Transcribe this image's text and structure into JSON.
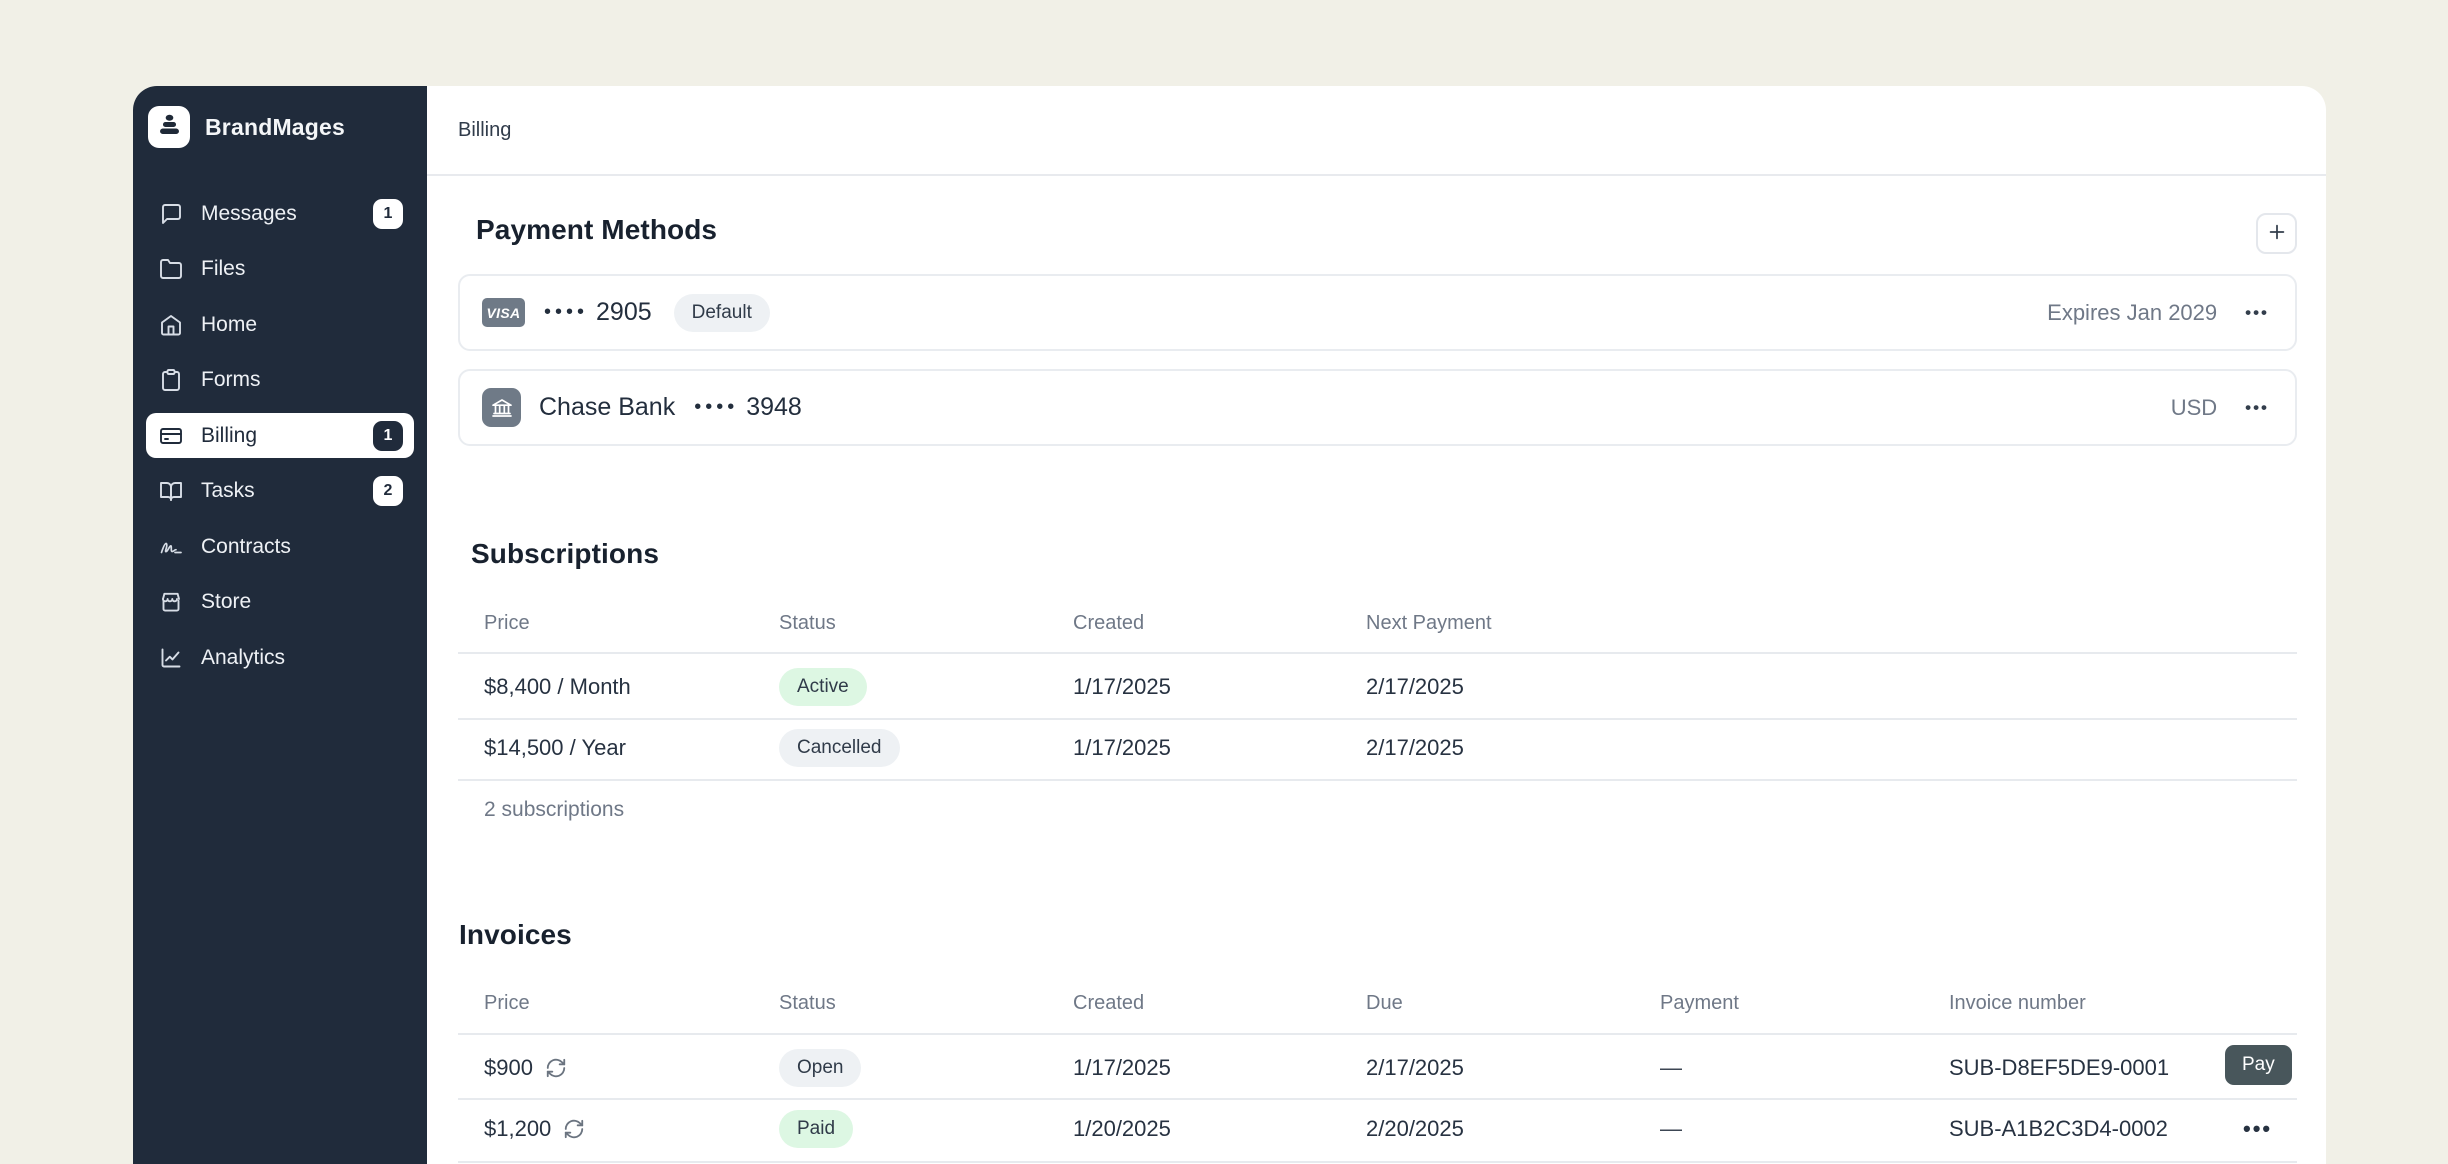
{
  "brand": {
    "name": "BrandMages",
    "logo_icon": "stacked-stones-icon"
  },
  "colors": {
    "page_bg": "#f1f0e7",
    "sidebar_bg": "#202b3b",
    "panel_bg": "#ffffff",
    "accent_dark": "#202b3b",
    "pill_green_bg": "#ddf7e3",
    "pill_gray_bg": "#eef1f4",
    "pay_button_bg": "#48565b",
    "card_brand_bg": "#6f7a87"
  },
  "sidebar": {
    "items": [
      {
        "label": "Messages",
        "icon": "chat-bubble-icon",
        "badge": "1",
        "active": false
      },
      {
        "label": "Files",
        "icon": "folder-icon",
        "badge": "",
        "active": false
      },
      {
        "label": "Home",
        "icon": "home-icon",
        "badge": "",
        "active": false
      },
      {
        "label": "Forms",
        "icon": "clipboard-icon",
        "badge": "",
        "active": false
      },
      {
        "label": "Billing",
        "icon": "credit-card-icon",
        "badge": "1",
        "active": true
      },
      {
        "label": "Tasks",
        "icon": "open-book-icon",
        "badge": "2",
        "active": false
      },
      {
        "label": "Contracts",
        "icon": "signature-icon",
        "badge": "",
        "active": false
      },
      {
        "label": "Store",
        "icon": "storefront-icon",
        "badge": "",
        "active": false
      },
      {
        "label": "Analytics",
        "icon": "chart-line-icon",
        "badge": "",
        "active": false
      }
    ]
  },
  "header": {
    "title": "Billing"
  },
  "payment_methods": {
    "title": "Payment Methods",
    "cards": [
      {
        "brand": "VISA",
        "mask": "••••",
        "last4": "2905",
        "badge": "Default",
        "right_text": "Expires Jan 2029",
        "menu": "•••"
      },
      {
        "name": "Chase Bank",
        "mask": "••••",
        "last4": "3948",
        "right_text": "USD",
        "menu": "•••"
      }
    ]
  },
  "subscriptions": {
    "title": "Subscriptions",
    "columns": [
      "Price",
      "Status",
      "Created",
      "Next Payment"
    ],
    "rows": [
      {
        "price": "$8,400 / Month",
        "status": "Active",
        "status_style": "green",
        "created": "1/17/2025",
        "next_payment": "2/17/2025"
      },
      {
        "price": "$14,500 / Year",
        "status": "Cancelled",
        "status_style": "gray",
        "created": "1/17/2025",
        "next_payment": "2/17/2025"
      }
    ],
    "footer": "2 subscriptions"
  },
  "invoices": {
    "title": "Invoices",
    "columns": [
      "Price",
      "Status",
      "Created",
      "Due",
      "Payment",
      "Invoice number"
    ],
    "rows": [
      {
        "price": "$900",
        "recurring": true,
        "status": "Open",
        "status_style": "gray",
        "created": "1/17/2025",
        "due": "2/17/2025",
        "payment": "—",
        "invoice_number": "SUB-D8EF5DE9-0001",
        "action_label": "Pay"
      },
      {
        "price": "$1,200",
        "recurring": true,
        "status": "Paid",
        "status_style": "green",
        "created": "1/20/2025",
        "due": "2/20/2025",
        "payment": "—",
        "invoice_number": "SUB-A1B2C3D4-0002",
        "menu": "•••"
      }
    ]
  }
}
